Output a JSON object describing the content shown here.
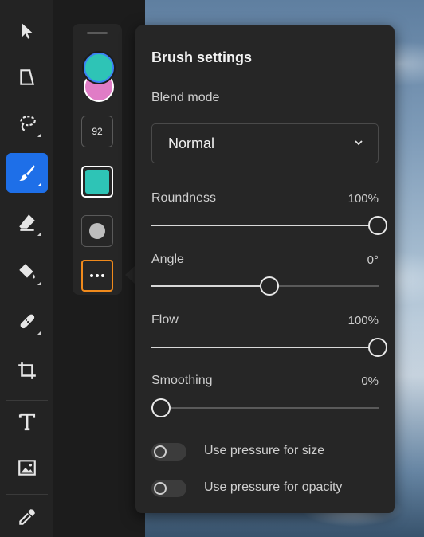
{
  "panel": {
    "title": "Brush settings",
    "blend_mode_label": "Blend mode",
    "blend_mode_value": "Normal",
    "sliders": [
      {
        "label": "Roundness",
        "display": "100%",
        "value": 100
      },
      {
        "label": "Angle",
        "display": "0°",
        "value": 50
      },
      {
        "label": "Flow",
        "display": "100%",
        "value": 100
      },
      {
        "label": "Smoothing",
        "display": "0%",
        "value": 0
      }
    ],
    "toggles": [
      {
        "label": "Use pressure for size",
        "on": false
      },
      {
        "label": "Use pressure for opacity",
        "on": false
      }
    ]
  },
  "options": {
    "brush_size": "92",
    "foreground_color": "#2ec4b6",
    "background_color": "#e07cc6",
    "tip_color": "#2ec4b6"
  },
  "toolbar": {
    "tools": [
      "select-tool",
      "transform-tool",
      "lasso-tool",
      "brush-tool",
      "eraser-tool",
      "paint-bucket-tool",
      "healing-tool",
      "crop-tool",
      "type-tool",
      "image-tool",
      "eyedropper-tool"
    ],
    "active_tool": "brush-tool"
  }
}
